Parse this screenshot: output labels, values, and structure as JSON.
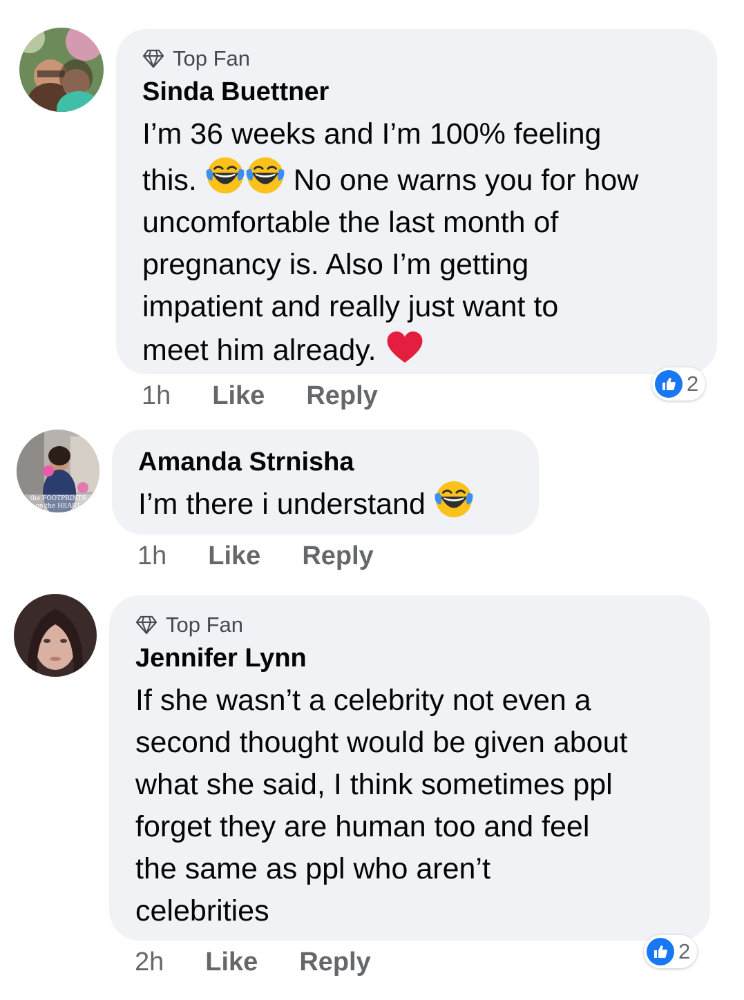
{
  "colors": {
    "bubble": "#f0f2f5",
    "meta": "#65676b",
    "like_blue": "#1877f2",
    "heart": "#e41e3f"
  },
  "comments": [
    {
      "badge": "Top Fan",
      "author": "Sinda Buettner",
      "text_lines": [
        "I’m 36 weeks and I’m 100% feeling",
        "this.",
        " No one warns you for how",
        "uncomfortable the last month of",
        "pregnancy is. Also I’m getting",
        "impatient and really just want to",
        "meet him already."
      ],
      "time": "1h",
      "like": "Like",
      "reply": "Reply",
      "reaction_count": "2",
      "emojis": [
        "laughing-tears-icon",
        "laughing-tears-icon",
        "red-heart-icon"
      ]
    },
    {
      "author": "Amanda Strnisha",
      "text_lines": [
        "I’m there i understand"
      ],
      "time": "1h",
      "like": "Like",
      "reply": "Reply",
      "avatar_caption": "the FOOTPRINTS on the HEART",
      "emojis": [
        "laughing-tears-icon"
      ]
    },
    {
      "badge": "Top Fan",
      "author": "Jennifer Lynn",
      "text_lines": [
        "If she wasn’t a celebrity not even a",
        "second thought would be given about",
        "what she said, I think sometimes ppl",
        "forget they are human too and feel",
        "the same as ppl who aren’t",
        "celebrities"
      ],
      "time": "2h",
      "like": "Like",
      "reply": "Reply",
      "reaction_count": "2"
    }
  ]
}
